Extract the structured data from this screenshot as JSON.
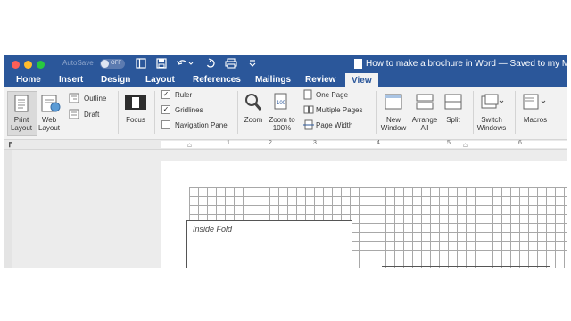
{
  "titlebar": {
    "autosave_label": "AutoSave",
    "autosave_state": "OFF",
    "doc_title": "How to make a brochure in Word — Saved to my M"
  },
  "tabs": [
    {
      "label": "Home"
    },
    {
      "label": "Insert"
    },
    {
      "label": "Design"
    },
    {
      "label": "Layout"
    },
    {
      "label": "References"
    },
    {
      "label": "Mailings"
    },
    {
      "label": "Review"
    },
    {
      "label": "View",
      "active": true
    }
  ],
  "ribbon": {
    "print_layout": "Print Layout",
    "web_layout": "Web Layout",
    "outline": "Outline",
    "draft": "Draft",
    "focus": "Focus",
    "ruler": {
      "label": "Ruler",
      "checked": true
    },
    "gridlines": {
      "label": "Gridlines",
      "checked": true
    },
    "navigation_pane": {
      "label": "Navigation Pane",
      "checked": false
    },
    "zoom": "Zoom",
    "zoom_100": "Zoom to 100%",
    "one_page": "One Page",
    "multiple_pages": "Multiple Pages",
    "page_width": "Page Width",
    "new_window": "New Window",
    "arrange_all": "Arrange All",
    "split": "Split",
    "switch_windows": "Switch Windows",
    "macros": "Macros"
  },
  "ruler": {
    "numbers": [
      "1",
      "2",
      "3",
      "4",
      "5",
      "6"
    ]
  },
  "document": {
    "fold_label": "Inside Fold"
  },
  "colors": {
    "titlebar": "#2b579a",
    "ribbon": "#f2f2f2",
    "traffic_close": "#fc5f57",
    "traffic_minimize": "#fdbc2e",
    "traffic_zoom": "#28c840"
  }
}
